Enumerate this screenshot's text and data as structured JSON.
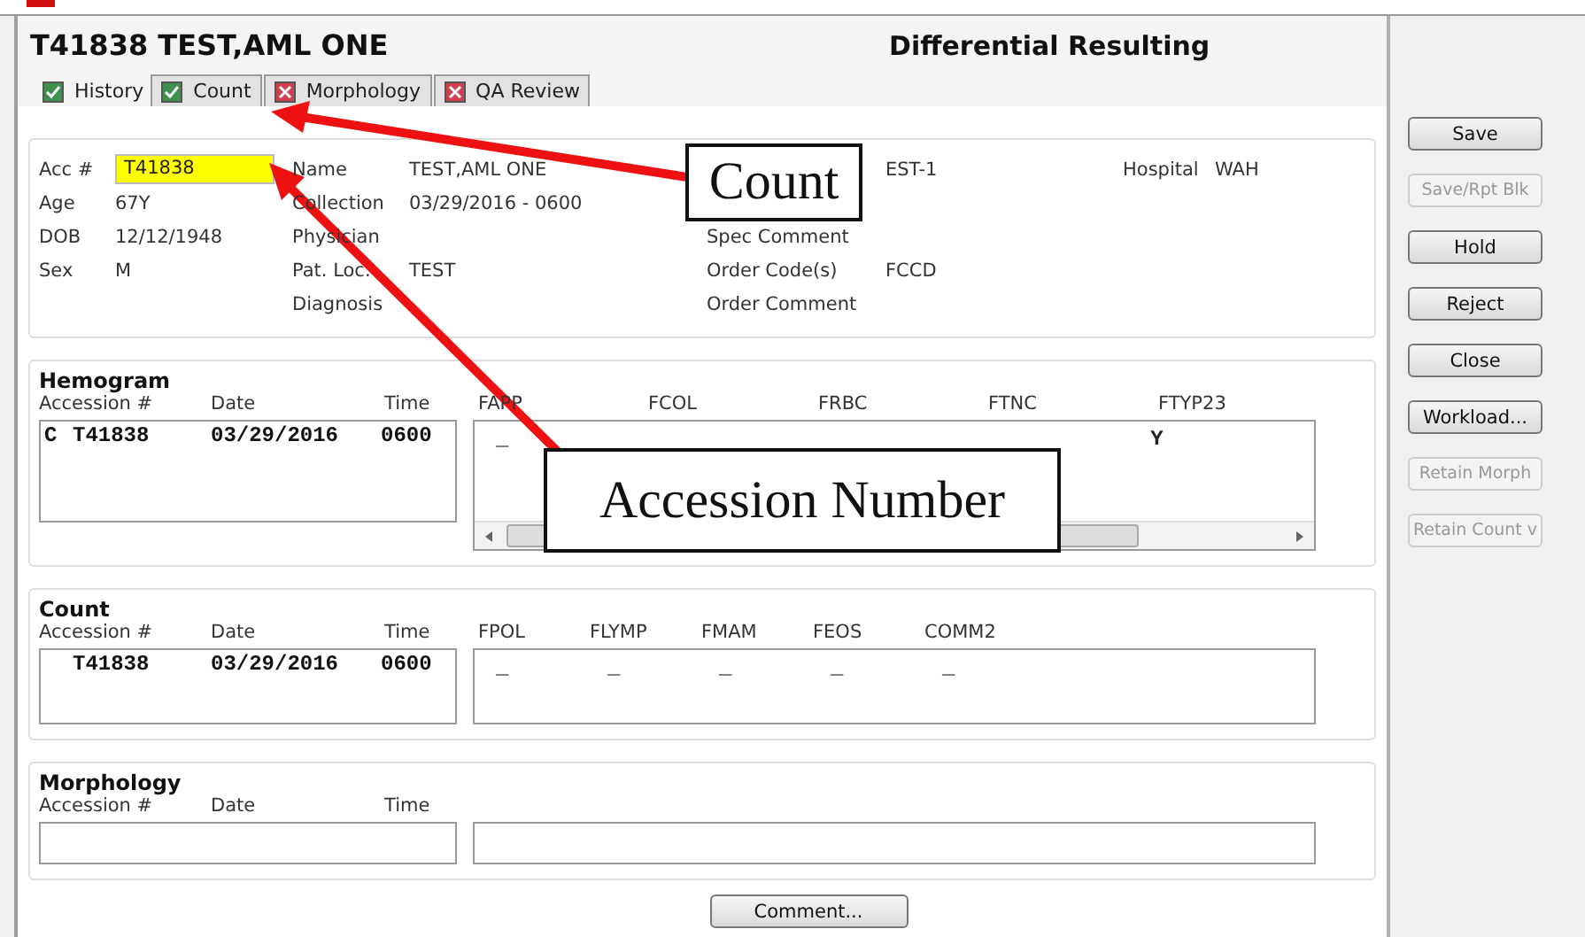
{
  "window": {
    "title": "T41838 TEST,AML ONE",
    "screen_title": "Differential Resulting"
  },
  "tabs": [
    {
      "label": "History",
      "selected": true,
      "checked": true
    },
    {
      "label": "Count",
      "selected": false,
      "checked": true
    },
    {
      "label": "Morphology",
      "selected": false,
      "checked": false
    },
    {
      "label": "QA Review",
      "selected": false,
      "checked": false
    }
  ],
  "patient_rows": [
    [
      {
        "kind": "input",
        "label": "Acc #",
        "value": "T41838"
      },
      {
        "kind": "text",
        "label": "Name",
        "value": "TEST,AML ONE"
      },
      {
        "kind": "text",
        "value": "EST-1"
      },
      {
        "kind": "text",
        "label": "Hospital",
        "value": "WAH"
      }
    ],
    [
      {
        "kind": "text",
        "label": "Age",
        "value": "67Y"
      },
      {
        "kind": "text",
        "label": "Collection",
        "value": "03/29/2016 - 0600"
      },
      null,
      null
    ],
    [
      {
        "kind": "text",
        "label": "DOB",
        "value": "12/12/1948"
      },
      {
        "kind": "text",
        "label": "Physician"
      },
      {
        "kind": "text",
        "label": "Spec Comment"
      },
      null
    ],
    [
      {
        "kind": "text",
        "label": "Sex",
        "value": "M"
      },
      {
        "kind": "text",
        "label": "Pat. Loc.",
        "value": "TEST"
      },
      {
        "kind": "text",
        "label": "Order Code(s)",
        "value": "FCCD"
      },
      null
    ],
    [
      null,
      {
        "kind": "text",
        "label": "Diagnosis"
      },
      {
        "kind": "text",
        "label": "Order Comment"
      },
      null
    ]
  ],
  "sections": [
    {
      "kind": "hemogram",
      "title": "Hemogram",
      "left_columns": [
        "Accession #",
        "Date",
        "Time"
      ],
      "rows": [
        {
          "flag": "C",
          "accession": "T41838",
          "date": "03/29/2016",
          "time": "0600"
        }
      ],
      "result_columns": [
        {
          "label": "FAPP",
          "value": "_"
        },
        {
          "label": "FCOL"
        },
        {
          "label": "FRBC"
        },
        {
          "label": "FTNC"
        },
        {
          "label": "FTYP23",
          "value": "Y"
        }
      ]
    },
    {
      "kind": "count",
      "title": "Count",
      "left_columns": [
        "Accession #",
        "Date",
        "Time"
      ],
      "rows": [
        {
          "accession": "T41838",
          "date": "03/29/2016",
          "time": "0600"
        }
      ],
      "result_columns": [
        {
          "label": "FPOL",
          "value": "_"
        },
        {
          "label": "FLYMP",
          "value": "_"
        },
        {
          "label": "FMAM",
          "value": "_"
        },
        {
          "label": "FEOS",
          "value": "_"
        },
        {
          "label": "COMM2",
          "value": "_"
        }
      ]
    },
    {
      "kind": "morphology",
      "title": "Morphology",
      "left_columns": [
        "Accession #",
        "Date",
        "Time"
      ]
    }
  ],
  "comment_button": "Comment...",
  "buttons": [
    {
      "label": "Save",
      "disabled": false
    },
    {
      "label": "Save/Rpt Blk",
      "disabled": true
    },
    {
      "label": "Hold",
      "disabled": false
    },
    {
      "label": "Reject",
      "disabled": false
    },
    {
      "label": "Close",
      "disabled": false
    },
    {
      "label": "Workload...",
      "disabled": false
    },
    {
      "label": "Retain Morph",
      "disabled": true
    },
    {
      "label": "Retain Count v",
      "disabled": true
    }
  ],
  "annotations": [
    {
      "text": "Count"
    },
    {
      "text": "Accession Number"
    }
  ]
}
